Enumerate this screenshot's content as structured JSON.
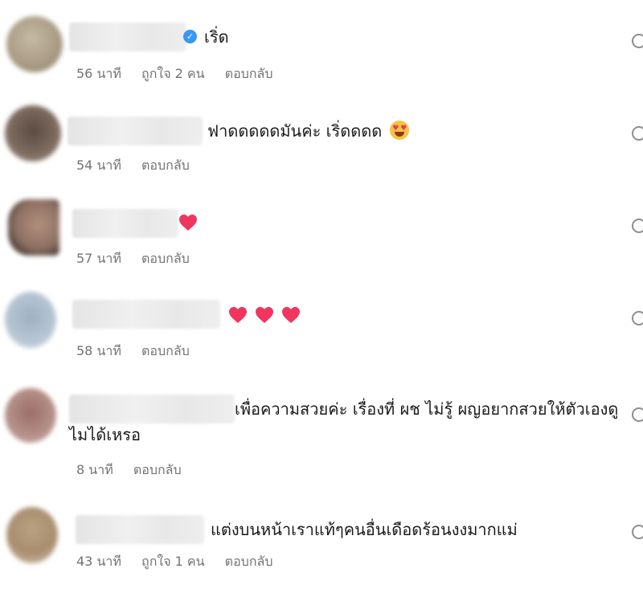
{
  "comments": [
    {
      "text": "เริ่ด",
      "time": "56 นาที",
      "likes": "ถูกใจ 2 คน",
      "reply": "ตอบกลับ",
      "verified": true
    },
    {
      "text": "ฟาดดดดดมันค่ะ เริ่ดดดด",
      "time": "54 นาที",
      "reply": "ตอบกลับ",
      "emoji": "smiling-face-with-heart-eyes"
    },
    {
      "time": "57 นาที",
      "reply": "ตอบกลับ",
      "emoji": "heart"
    },
    {
      "time": "58 นาที",
      "reply": "ตอบกลับ",
      "emoji": "three-hearts"
    },
    {
      "text": "เพื่อความสวยค่ะ เรื่องที่ ผช ไม่รู้ ผญอยากสวยให้ตัวเองดูไมได้เหรอ",
      "time": "8 นาที",
      "reply": "ตอบกลับ"
    },
    {
      "text": "แต่งบนหน้าเราแท้ๆคนอื่นเดือดร้อนงงมากแม่",
      "time": "43 นาที",
      "likes": "ถูกใจ 1 คน",
      "reply": "ตอบกลับ"
    }
  ],
  "colors": {
    "heart": "#f0365f",
    "verified": "#3897f0",
    "meta": "#737373"
  }
}
